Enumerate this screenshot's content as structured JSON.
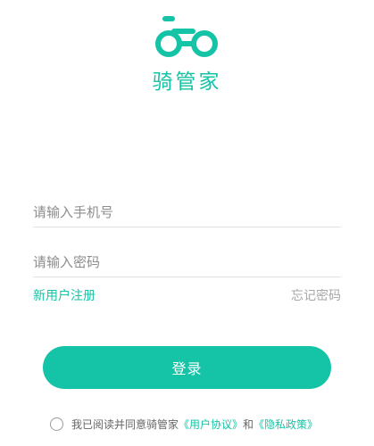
{
  "app": {
    "name": "骑管家",
    "logo_icon": "bicycle-icon",
    "brand_color": "#15c3a6"
  },
  "form": {
    "phone_placeholder": "请输入手机号",
    "phone_value": "",
    "password_placeholder": "请输入密码",
    "password_value": ""
  },
  "links": {
    "register": "新用户注册",
    "forgot_password": "忘记密码"
  },
  "login_button": "登录",
  "agreement": {
    "checked": false,
    "prefix": "我已阅读并同意骑管家",
    "user_agreement": "《用户协议》",
    "conjunction": "和",
    "privacy_policy": "《隐私政策》"
  }
}
